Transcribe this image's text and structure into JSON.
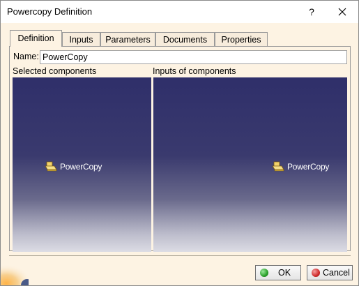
{
  "window": {
    "title": "Powercopy Definition",
    "help_label": "?"
  },
  "tabs": [
    {
      "label": "Definition",
      "active": true
    },
    {
      "label": "Inputs",
      "active": false
    },
    {
      "label": "Parameters",
      "active": false
    },
    {
      "label": "Documents",
      "active": false
    },
    {
      "label": "Properties",
      "active": false
    }
  ],
  "definition": {
    "name_label": "Name:",
    "name_value": "PowerCopy",
    "selected_components_label": "Selected components",
    "inputs_of_components_label": "Inputs of components",
    "selected_tree_item": "PowerCopy",
    "inputs_tree_item": "PowerCopy"
  },
  "buttons": {
    "ok_label": "OK",
    "cancel_label": "Cancel"
  },
  "colors": {
    "viewer_top": "#2f2f6a",
    "viewer_bottom": "#dcdce4",
    "dialog_bg": "#fdf3e3",
    "ok_icon": "#2aa02a",
    "cancel_icon": "#d02a2a"
  },
  "icons": {
    "powercopy_item": "powercopy-icon",
    "close": "close-icon",
    "ok": "ok-icon",
    "cancel": "cancel-icon"
  }
}
